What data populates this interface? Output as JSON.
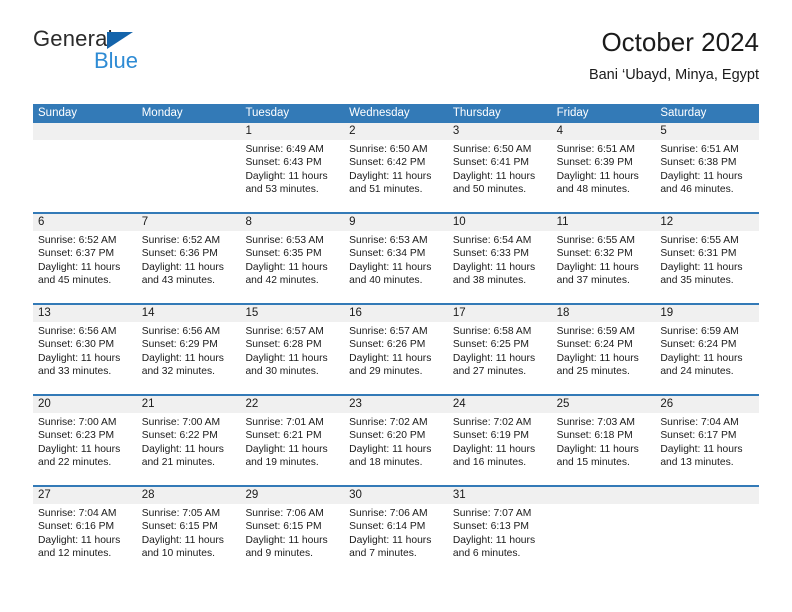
{
  "brand": {
    "name_dark": "General",
    "name_blue": "Blue",
    "color_dark": "#2b2b2b",
    "color_blue": "#2e8bd4",
    "triangle_color": "#1464ab"
  },
  "header": {
    "title": "October 2024",
    "subtitle": "Bani ‘Ubayd, Minya, Egypt"
  },
  "theme": {
    "header_bg": "#337ab7",
    "header_text": "#ffffff",
    "day_number_bg": "#f0f0f0",
    "cell_bg": "#ffffff",
    "row_divider": "#337ab7"
  },
  "weekdays": [
    "Sunday",
    "Monday",
    "Tuesday",
    "Wednesday",
    "Thursday",
    "Friday",
    "Saturday"
  ],
  "weeks": [
    [
      {
        "day": "",
        "sunrise": "",
        "sunset": "",
        "daylight_line1": "",
        "daylight_line2": "",
        "empty": true
      },
      {
        "day": "",
        "sunrise": "",
        "sunset": "",
        "daylight_line1": "",
        "daylight_line2": "",
        "empty": true
      },
      {
        "day": "1",
        "sunrise": "Sunrise: 6:49 AM",
        "sunset": "Sunset: 6:43 PM",
        "daylight_line1": "Daylight: 11 hours",
        "daylight_line2": "and 53 minutes."
      },
      {
        "day": "2",
        "sunrise": "Sunrise: 6:50 AM",
        "sunset": "Sunset: 6:42 PM",
        "daylight_line1": "Daylight: 11 hours",
        "daylight_line2": "and 51 minutes."
      },
      {
        "day": "3",
        "sunrise": "Sunrise: 6:50 AM",
        "sunset": "Sunset: 6:41 PM",
        "daylight_line1": "Daylight: 11 hours",
        "daylight_line2": "and 50 minutes."
      },
      {
        "day": "4",
        "sunrise": "Sunrise: 6:51 AM",
        "sunset": "Sunset: 6:39 PM",
        "daylight_line1": "Daylight: 11 hours",
        "daylight_line2": "and 48 minutes."
      },
      {
        "day": "5",
        "sunrise": "Sunrise: 6:51 AM",
        "sunset": "Sunset: 6:38 PM",
        "daylight_line1": "Daylight: 11 hours",
        "daylight_line2": "and 46 minutes."
      }
    ],
    [
      {
        "day": "6",
        "sunrise": "Sunrise: 6:52 AM",
        "sunset": "Sunset: 6:37 PM",
        "daylight_line1": "Daylight: 11 hours",
        "daylight_line2": "and 45 minutes."
      },
      {
        "day": "7",
        "sunrise": "Sunrise: 6:52 AM",
        "sunset": "Sunset: 6:36 PM",
        "daylight_line1": "Daylight: 11 hours",
        "daylight_line2": "and 43 minutes."
      },
      {
        "day": "8",
        "sunrise": "Sunrise: 6:53 AM",
        "sunset": "Sunset: 6:35 PM",
        "daylight_line1": "Daylight: 11 hours",
        "daylight_line2": "and 42 minutes."
      },
      {
        "day": "9",
        "sunrise": "Sunrise: 6:53 AM",
        "sunset": "Sunset: 6:34 PM",
        "daylight_line1": "Daylight: 11 hours",
        "daylight_line2": "and 40 minutes."
      },
      {
        "day": "10",
        "sunrise": "Sunrise: 6:54 AM",
        "sunset": "Sunset: 6:33 PM",
        "daylight_line1": "Daylight: 11 hours",
        "daylight_line2": "and 38 minutes."
      },
      {
        "day": "11",
        "sunrise": "Sunrise: 6:55 AM",
        "sunset": "Sunset: 6:32 PM",
        "daylight_line1": "Daylight: 11 hours",
        "daylight_line2": "and 37 minutes."
      },
      {
        "day": "12",
        "sunrise": "Sunrise: 6:55 AM",
        "sunset": "Sunset: 6:31 PM",
        "daylight_line1": "Daylight: 11 hours",
        "daylight_line2": "and 35 minutes."
      }
    ],
    [
      {
        "day": "13",
        "sunrise": "Sunrise: 6:56 AM",
        "sunset": "Sunset: 6:30 PM",
        "daylight_line1": "Daylight: 11 hours",
        "daylight_line2": "and 33 minutes."
      },
      {
        "day": "14",
        "sunrise": "Sunrise: 6:56 AM",
        "sunset": "Sunset: 6:29 PM",
        "daylight_line1": "Daylight: 11 hours",
        "daylight_line2": "and 32 minutes."
      },
      {
        "day": "15",
        "sunrise": "Sunrise: 6:57 AM",
        "sunset": "Sunset: 6:28 PM",
        "daylight_line1": "Daylight: 11 hours",
        "daylight_line2": "and 30 minutes."
      },
      {
        "day": "16",
        "sunrise": "Sunrise: 6:57 AM",
        "sunset": "Sunset: 6:26 PM",
        "daylight_line1": "Daylight: 11 hours",
        "daylight_line2": "and 29 minutes."
      },
      {
        "day": "17",
        "sunrise": "Sunrise: 6:58 AM",
        "sunset": "Sunset: 6:25 PM",
        "daylight_line1": "Daylight: 11 hours",
        "daylight_line2": "and 27 minutes."
      },
      {
        "day": "18",
        "sunrise": "Sunrise: 6:59 AM",
        "sunset": "Sunset: 6:24 PM",
        "daylight_line1": "Daylight: 11 hours",
        "daylight_line2": "and 25 minutes."
      },
      {
        "day": "19",
        "sunrise": "Sunrise: 6:59 AM",
        "sunset": "Sunset: 6:24 PM",
        "daylight_line1": "Daylight: 11 hours",
        "daylight_line2": "and 24 minutes."
      }
    ],
    [
      {
        "day": "20",
        "sunrise": "Sunrise: 7:00 AM",
        "sunset": "Sunset: 6:23 PM",
        "daylight_line1": "Daylight: 11 hours",
        "daylight_line2": "and 22 minutes."
      },
      {
        "day": "21",
        "sunrise": "Sunrise: 7:00 AM",
        "sunset": "Sunset: 6:22 PM",
        "daylight_line1": "Daylight: 11 hours",
        "daylight_line2": "and 21 minutes."
      },
      {
        "day": "22",
        "sunrise": "Sunrise: 7:01 AM",
        "sunset": "Sunset: 6:21 PM",
        "daylight_line1": "Daylight: 11 hours",
        "daylight_line2": "and 19 minutes."
      },
      {
        "day": "23",
        "sunrise": "Sunrise: 7:02 AM",
        "sunset": "Sunset: 6:20 PM",
        "daylight_line1": "Daylight: 11 hours",
        "daylight_line2": "and 18 minutes."
      },
      {
        "day": "24",
        "sunrise": "Sunrise: 7:02 AM",
        "sunset": "Sunset: 6:19 PM",
        "daylight_line1": "Daylight: 11 hours",
        "daylight_line2": "and 16 minutes."
      },
      {
        "day": "25",
        "sunrise": "Sunrise: 7:03 AM",
        "sunset": "Sunset: 6:18 PM",
        "daylight_line1": "Daylight: 11 hours",
        "daylight_line2": "and 15 minutes."
      },
      {
        "day": "26",
        "sunrise": "Sunrise: 7:04 AM",
        "sunset": "Sunset: 6:17 PM",
        "daylight_line1": "Daylight: 11 hours",
        "daylight_line2": "and 13 minutes."
      }
    ],
    [
      {
        "day": "27",
        "sunrise": "Sunrise: 7:04 AM",
        "sunset": "Sunset: 6:16 PM",
        "daylight_line1": "Daylight: 11 hours",
        "daylight_line2": "and 12 minutes."
      },
      {
        "day": "28",
        "sunrise": "Sunrise: 7:05 AM",
        "sunset": "Sunset: 6:15 PM",
        "daylight_line1": "Daylight: 11 hours",
        "daylight_line2": "and 10 minutes."
      },
      {
        "day": "29",
        "sunrise": "Sunrise: 7:06 AM",
        "sunset": "Sunset: 6:15 PM",
        "daylight_line1": "Daylight: 11 hours",
        "daylight_line2": "and 9 minutes."
      },
      {
        "day": "30",
        "sunrise": "Sunrise: 7:06 AM",
        "sunset": "Sunset: 6:14 PM",
        "daylight_line1": "Daylight: 11 hours",
        "daylight_line2": "and 7 minutes."
      },
      {
        "day": "31",
        "sunrise": "Sunrise: 7:07 AM",
        "sunset": "Sunset: 6:13 PM",
        "daylight_line1": "Daylight: 11 hours",
        "daylight_line2": "and 6 minutes."
      },
      {
        "day": "",
        "sunrise": "",
        "sunset": "",
        "daylight_line1": "",
        "daylight_line2": "",
        "empty": true
      },
      {
        "day": "",
        "sunrise": "",
        "sunset": "",
        "daylight_line1": "",
        "daylight_line2": "",
        "empty": true
      }
    ]
  ]
}
